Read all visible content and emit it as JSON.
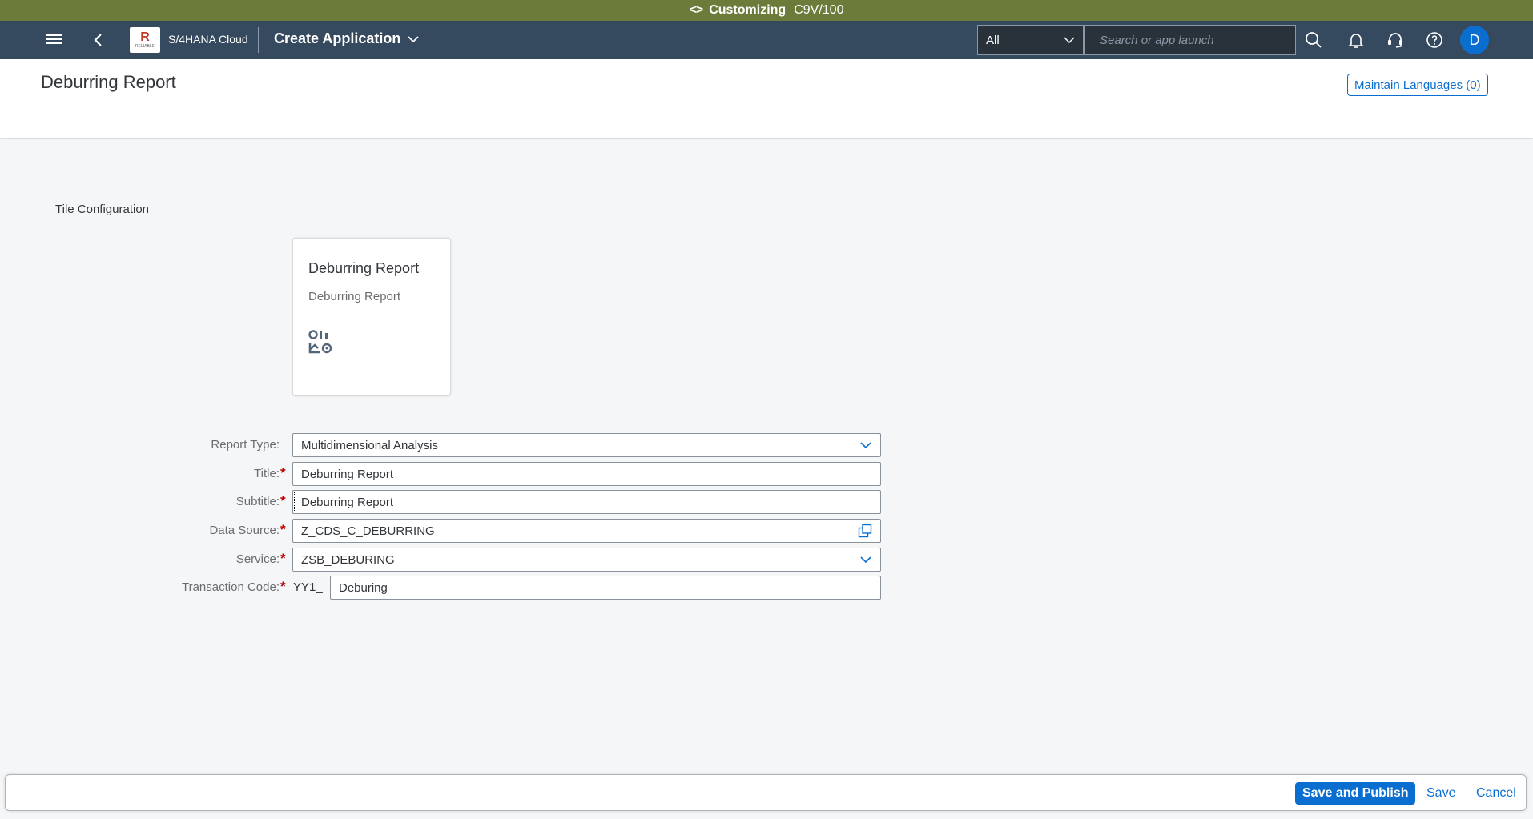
{
  "system_bar": {
    "label": "Customizing",
    "system": "C9V/100"
  },
  "shell": {
    "logo_text": "R",
    "logo_subtext": "RELIABLE",
    "product": "S/4HANA Cloud",
    "app_title": "Create Application",
    "search_scope": "All",
    "search_placeholder": "Search or app launch",
    "avatar_initial": "D"
  },
  "page": {
    "title": "Deburring Report",
    "maintain_languages": "Maintain Languages (0)"
  },
  "tile_config": {
    "section_title": "Tile Configuration",
    "tile_title": "Deburring Report",
    "tile_subtitle": "Deburring Report",
    "tile_icon": "analytics-icon"
  },
  "form": {
    "report_type": {
      "label": "Report Type:",
      "value": "Multidimensional Analysis"
    },
    "title": {
      "label": "Title:",
      "value": "Deburring Report"
    },
    "subtitle": {
      "label": "Subtitle:",
      "value": "Deburring Report"
    },
    "data_source": {
      "label": "Data Source:",
      "value": "Z_CDS_C_DEBURRING"
    },
    "service": {
      "label": "Service:",
      "value": "ZSB_DEBURING"
    },
    "transaction_code": {
      "label": "Transaction Code:",
      "prefix": "YY1_",
      "value": "Deburing"
    },
    "required_marker": "*"
  },
  "footer": {
    "save_publish": "Save and Publish",
    "save": "Save",
    "cancel": "Cancel"
  },
  "colors": {
    "system_bar": "#6b7c3a",
    "shell": "#354a5f",
    "accent": "#0a6ed1",
    "required": "#bb0000"
  }
}
